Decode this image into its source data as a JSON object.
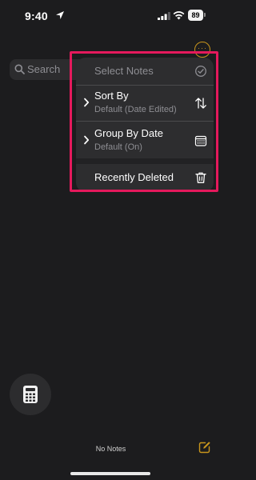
{
  "status_bar": {
    "time": "9:40",
    "battery": "89",
    "icons": [
      "location-arrow-icon",
      "signal-bars-icon",
      "wifi-icon",
      "battery-icon"
    ]
  },
  "toolbar": {
    "more_icon": "ellipsis-circle-icon",
    "more_label": "···"
  },
  "search": {
    "placeholder": "Search",
    "icon": "search-icon"
  },
  "menu": {
    "items": [
      {
        "label": "Select Notes",
        "subtitle": "",
        "icon": "checkmark-circle-icon"
      },
      {
        "label": "Sort By",
        "subtitle": "Default (Date Edited)",
        "icon": "arrow-up-down-icon"
      },
      {
        "label": "Group By Date",
        "subtitle": "Default (On)",
        "icon": "calendar-icon"
      },
      {
        "label": "Recently Deleted",
        "subtitle": "",
        "icon": "trash-icon"
      }
    ]
  },
  "highlight_color": "#e5195c",
  "accent_color": "#c8951c",
  "footer": {
    "status": "No Notes",
    "compose_icon": "compose-icon"
  },
  "floating_button": {
    "icon": "calculator-icon"
  }
}
